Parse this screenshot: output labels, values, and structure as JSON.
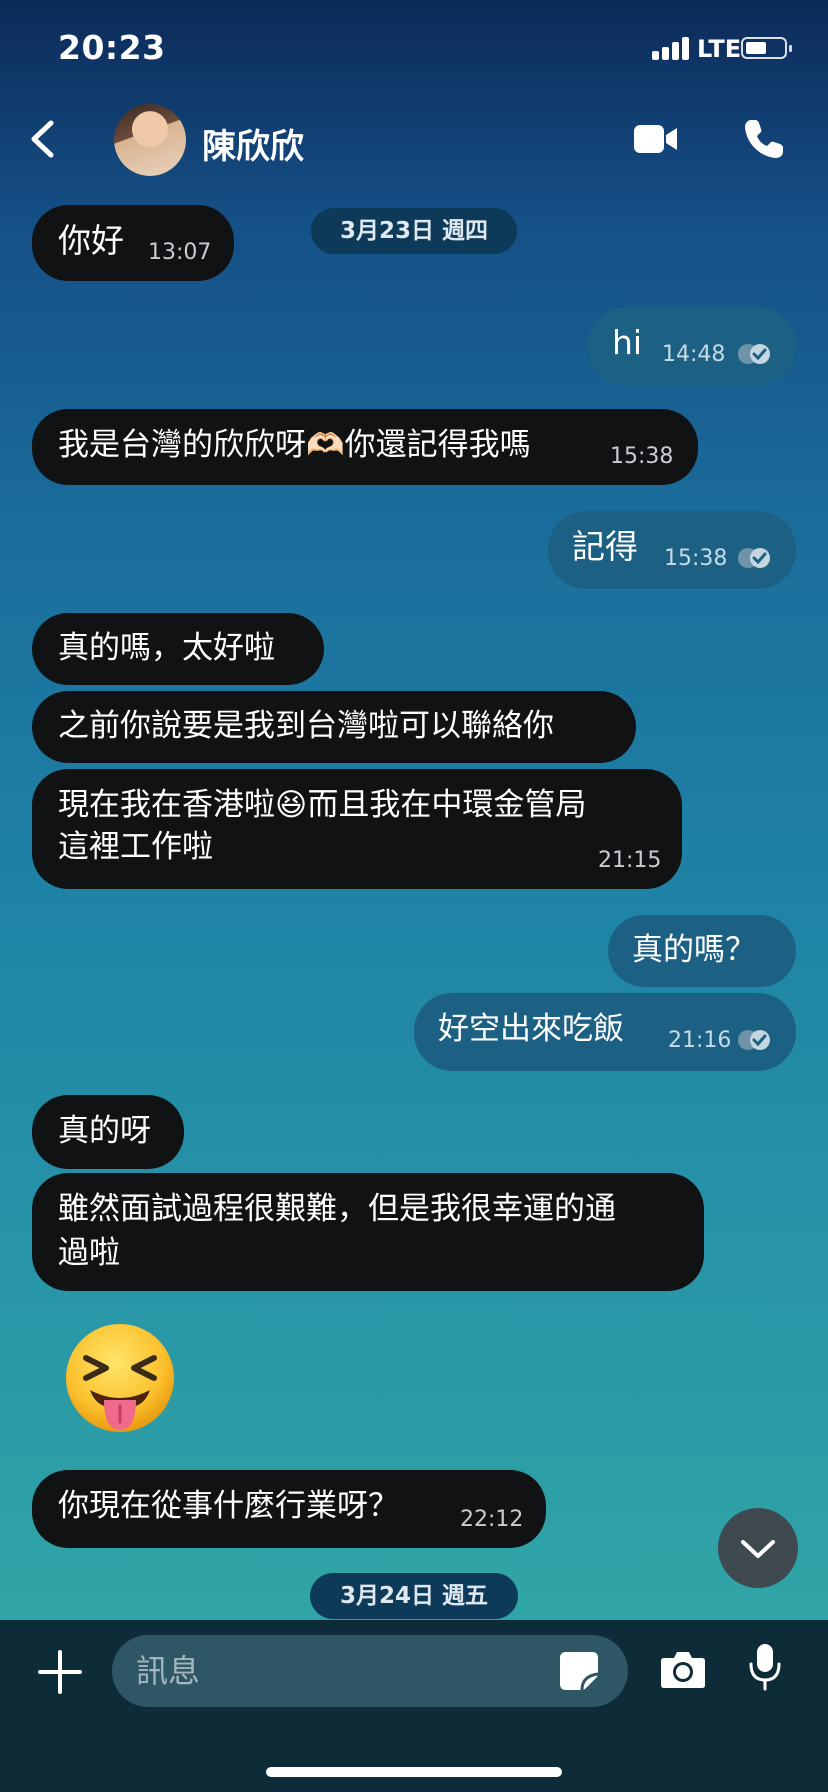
{
  "status_bar": {
    "time": "20:23",
    "network": "LTE",
    "battery_level": 0.55
  },
  "header": {
    "contact_name": "陳欣欣",
    "icons": [
      "chevron-left-icon",
      "avatar",
      "video-camera-icon",
      "phone-icon"
    ]
  },
  "dates": [
    "3月23日 週四",
    "3月24日 週五"
  ],
  "messages": [
    {
      "dir": "in",
      "text": "你好",
      "time": "13:07"
    },
    {
      "dir": "out",
      "text": "hi",
      "time": "14:48",
      "read": true
    },
    {
      "dir": "in",
      "text": "我是台灣的欣欣呀🫶🏻你還記得我嗎",
      "time": "15:38"
    },
    {
      "dir": "out",
      "text": "記得",
      "time": "15:38",
      "read": true
    },
    {
      "dir": "in",
      "text": "真的嗎，太好啦"
    },
    {
      "dir": "in",
      "text": "之前你說要是我到台灣啦可以聯絡你"
    },
    {
      "dir": "in",
      "line1": "現在我在香港啦😆而且我在中環金管局",
      "line2": "這裡工作啦",
      "time": "21:15"
    },
    {
      "dir": "out",
      "text": "真的嗎？"
    },
    {
      "dir": "out",
      "text": "好空出來吃飯",
      "time": "21:16",
      "read": true
    },
    {
      "dir": "in",
      "text": "真的呀"
    },
    {
      "dir": "in",
      "line1": "雖然面試過程很艱難，但是我很幸運的通",
      "line2": "過啦"
    },
    {
      "dir": "in",
      "sticker": "squinting-face-with-tongue"
    },
    {
      "dir": "in",
      "text": "你現在從事什麼行業呀？",
      "time": "22:12"
    }
  ],
  "composer": {
    "placeholder": "訊息"
  },
  "colors": {
    "incoming_bubble": "#111214",
    "outgoing_bubble": "#1c6184",
    "date_pill": "#0e3a59"
  }
}
